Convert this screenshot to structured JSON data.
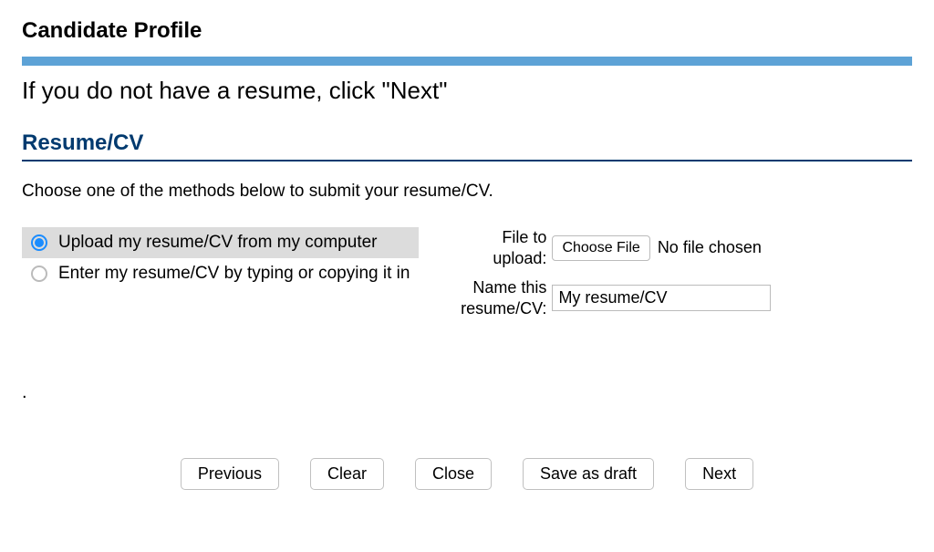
{
  "page_title": "Candidate Profile",
  "instruction": "If you do not have a resume, click \"Next\"",
  "section_heading": "Resume/CV",
  "sub_instruction": "Choose one of the methods below to submit your resume/CV.",
  "radio_options": {
    "upload": "Upload my resume/CV from my computer",
    "type": "Enter my resume/CV by typing or copying it in"
  },
  "fields": {
    "file_label": "File to upload:",
    "choose_file_label": "Choose File",
    "file_status": "No file chosen",
    "name_label": "Name this resume/CV:",
    "name_value": "My resume/CV"
  },
  "period": ".",
  "buttons": {
    "previous": "Previous",
    "clear": "Clear",
    "close": "Close",
    "save_draft": "Save as draft",
    "next": "Next"
  }
}
